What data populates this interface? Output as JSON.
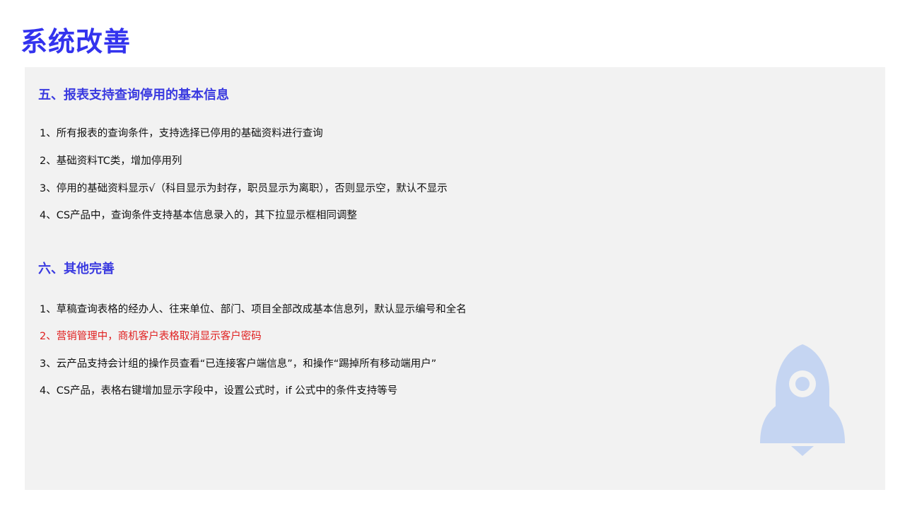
{
  "title": "系统改善",
  "sections": [
    {
      "heading": "五、报表支持查询停用的基本信息",
      "items": [
        "1、所有报表的查询条件，支持选择已停用的基础资料进行查询",
        "2、基础资料TC类，增加停用列",
        "3、停用的基础资料显示√（科目显示为封存，职员显示为离职），否则显示空，默认不显示",
        "4、CS产品中，查询条件支持基本信息录入的，其下拉显示框相同调整"
      ]
    },
    {
      "heading": "六、其他完善",
      "items": [
        "1、草稿查询表格的经办人、往来单位、部门、项目全部改成基本信息列，默认显示编号和全名",
        "2、营销管理中，商机客户表格取消显示客户密码",
        "3、云产品支持会计组的操作员查看“已连接客户端信息”，和操作“踢掉所有移动端用户”",
        "4、CS产品，表格右键增加显示字段中，设置公式时，if 公式中的条件支持等号"
      ]
    }
  ],
  "colors": {
    "title": "#3333ee",
    "heading": "#3a3ae0",
    "panel_background": "#f2f2f2",
    "highlight_item": "#e02020",
    "rocket": "#c5d5f2"
  },
  "decoration": {
    "icon": "rocket-icon"
  }
}
